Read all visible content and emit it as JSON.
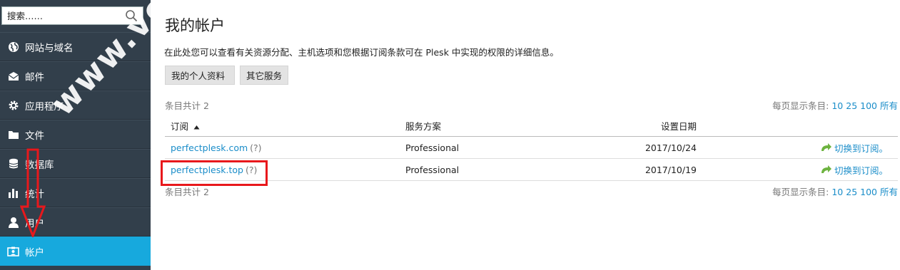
{
  "sidebar": {
    "search_placeholder": "搜索……",
    "items": [
      {
        "label": "网站与域名",
        "icon": "globe-icon"
      },
      {
        "label": "邮件",
        "icon": "envelope-icon"
      },
      {
        "label": "应用程序",
        "icon": "gear-icon"
      },
      {
        "label": "文件",
        "icon": "folder-icon"
      },
      {
        "label": "数据库",
        "icon": "database-icon"
      },
      {
        "label": "统计",
        "icon": "bar-chart-icon"
      },
      {
        "label": "用户",
        "icon": "user-icon"
      },
      {
        "label": "帐户",
        "icon": "id-card-icon",
        "active": true
      }
    ]
  },
  "main": {
    "title": "我的帐户",
    "description": "在此处您可以查看有关资源分配、主机选项和您根据订阅条款可在 Plesk 中实现的权限的详细信息。",
    "buttons": {
      "profile": "我的个人资料",
      "other_services": "其它服务"
    },
    "total_top": "条目共计 2",
    "total_bottom": "条目共计 2",
    "per_page_label": "每页显示条目:",
    "per_page_options": [
      "10",
      "25",
      "100",
      "所有"
    ],
    "table": {
      "headers": {
        "subscription": "订阅",
        "plan": "服务方案",
        "date": "设置日期"
      },
      "rows": [
        {
          "domain": "perfectplesk.com",
          "help": "(?)",
          "plan": "Professional",
          "date": "2017/10/24",
          "action": "切换到订阅。"
        },
        {
          "domain": "perfectplesk.top",
          "help": "(?)",
          "plan": "Professional",
          "date": "2017/10/19",
          "action": "切换到订阅。"
        }
      ]
    }
  },
  "watermark": "www.ve",
  "colors": {
    "sidebar_bg": "#323f4b",
    "active_bg": "#17a9dd",
    "link": "#1a8dc9",
    "annotation_red": "#e8181c"
  }
}
